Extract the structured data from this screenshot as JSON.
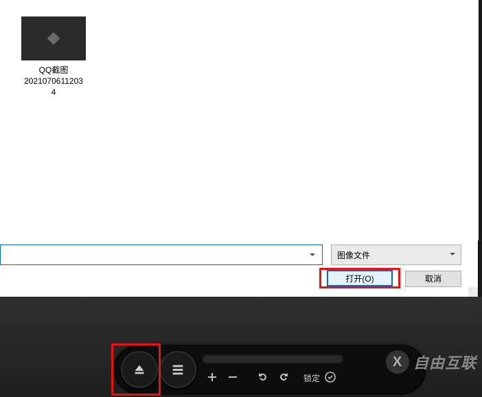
{
  "file": {
    "name_line1": "QQ截图",
    "name_line2": "2021070611203",
    "name_line3": "4",
    "icon": "image-file-icon"
  },
  "filename_input": {
    "value": "",
    "placeholder": ""
  },
  "file_type": {
    "label": "图像文件"
  },
  "buttons": {
    "open": "打开(O)",
    "cancel": "取消"
  },
  "player": {
    "lock_label": "锁定"
  },
  "watermark": {
    "text": "自由互联"
  }
}
